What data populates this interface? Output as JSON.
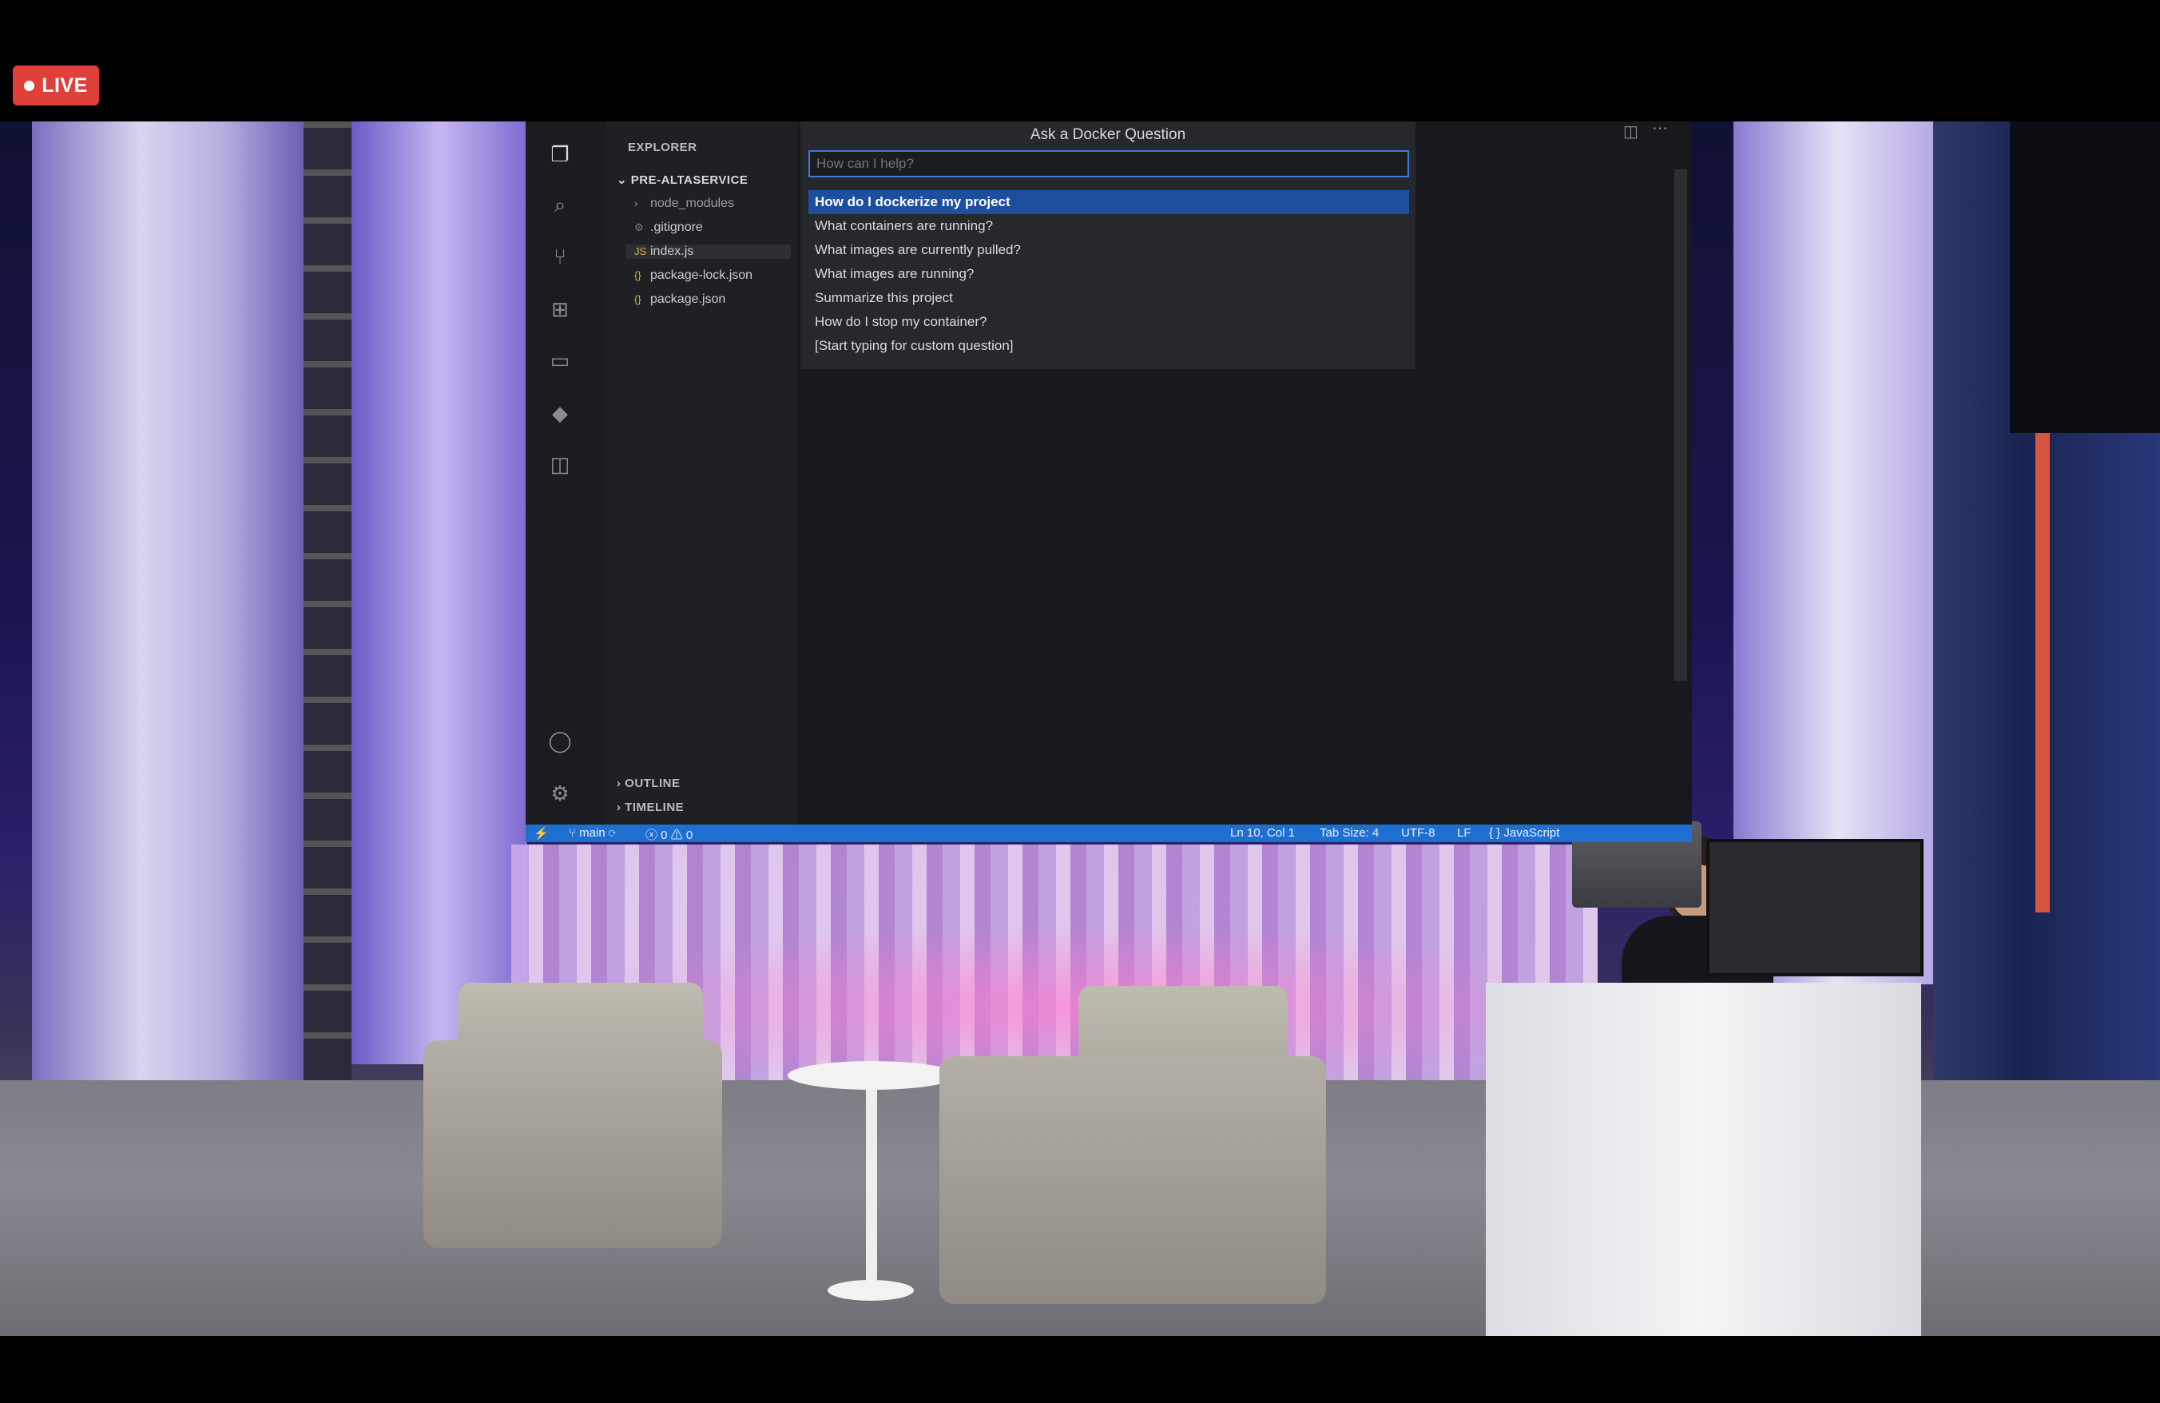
{
  "badge": {
    "label": "LIVE"
  },
  "explorer": {
    "header": "EXPLORER",
    "project": "PRE-ALTASERVICE",
    "files": [
      {
        "name": "node_modules",
        "icon": "chevron-right-icon"
      },
      {
        "name": ".gitignore",
        "icon": "gear-icon"
      },
      {
        "name": "index.js",
        "icon": "js-file-icon"
      },
      {
        "name": "package-lock.json",
        "icon": "json-file-icon"
      },
      {
        "name": "package.json",
        "icon": "json-file-icon"
      }
    ],
    "outline": "OUTLINE",
    "timeline": "TIMELINE"
  },
  "palette": {
    "title": "Ask a Docker Question",
    "placeholder": "How can I help?",
    "options": [
      "How do I dockerize my project",
      "What containers are running?",
      "What images are currently pulled?",
      "What images are running?",
      "Summarize this project",
      "How do I stop my container?",
      "[Start typing for custom question]"
    ]
  },
  "statusbar": {
    "branch": "main",
    "problems": "0",
    "warnings": "0",
    "position": "Ln 10, Col 1",
    "tab_size": "Tab Size: 4",
    "encoding": "UTF-8",
    "eol": "LF",
    "language": "JavaScript"
  },
  "colors": {
    "live_badge": "#e0403a",
    "selection": "#1d4f9e",
    "status_bar": "#1f6fd1"
  }
}
